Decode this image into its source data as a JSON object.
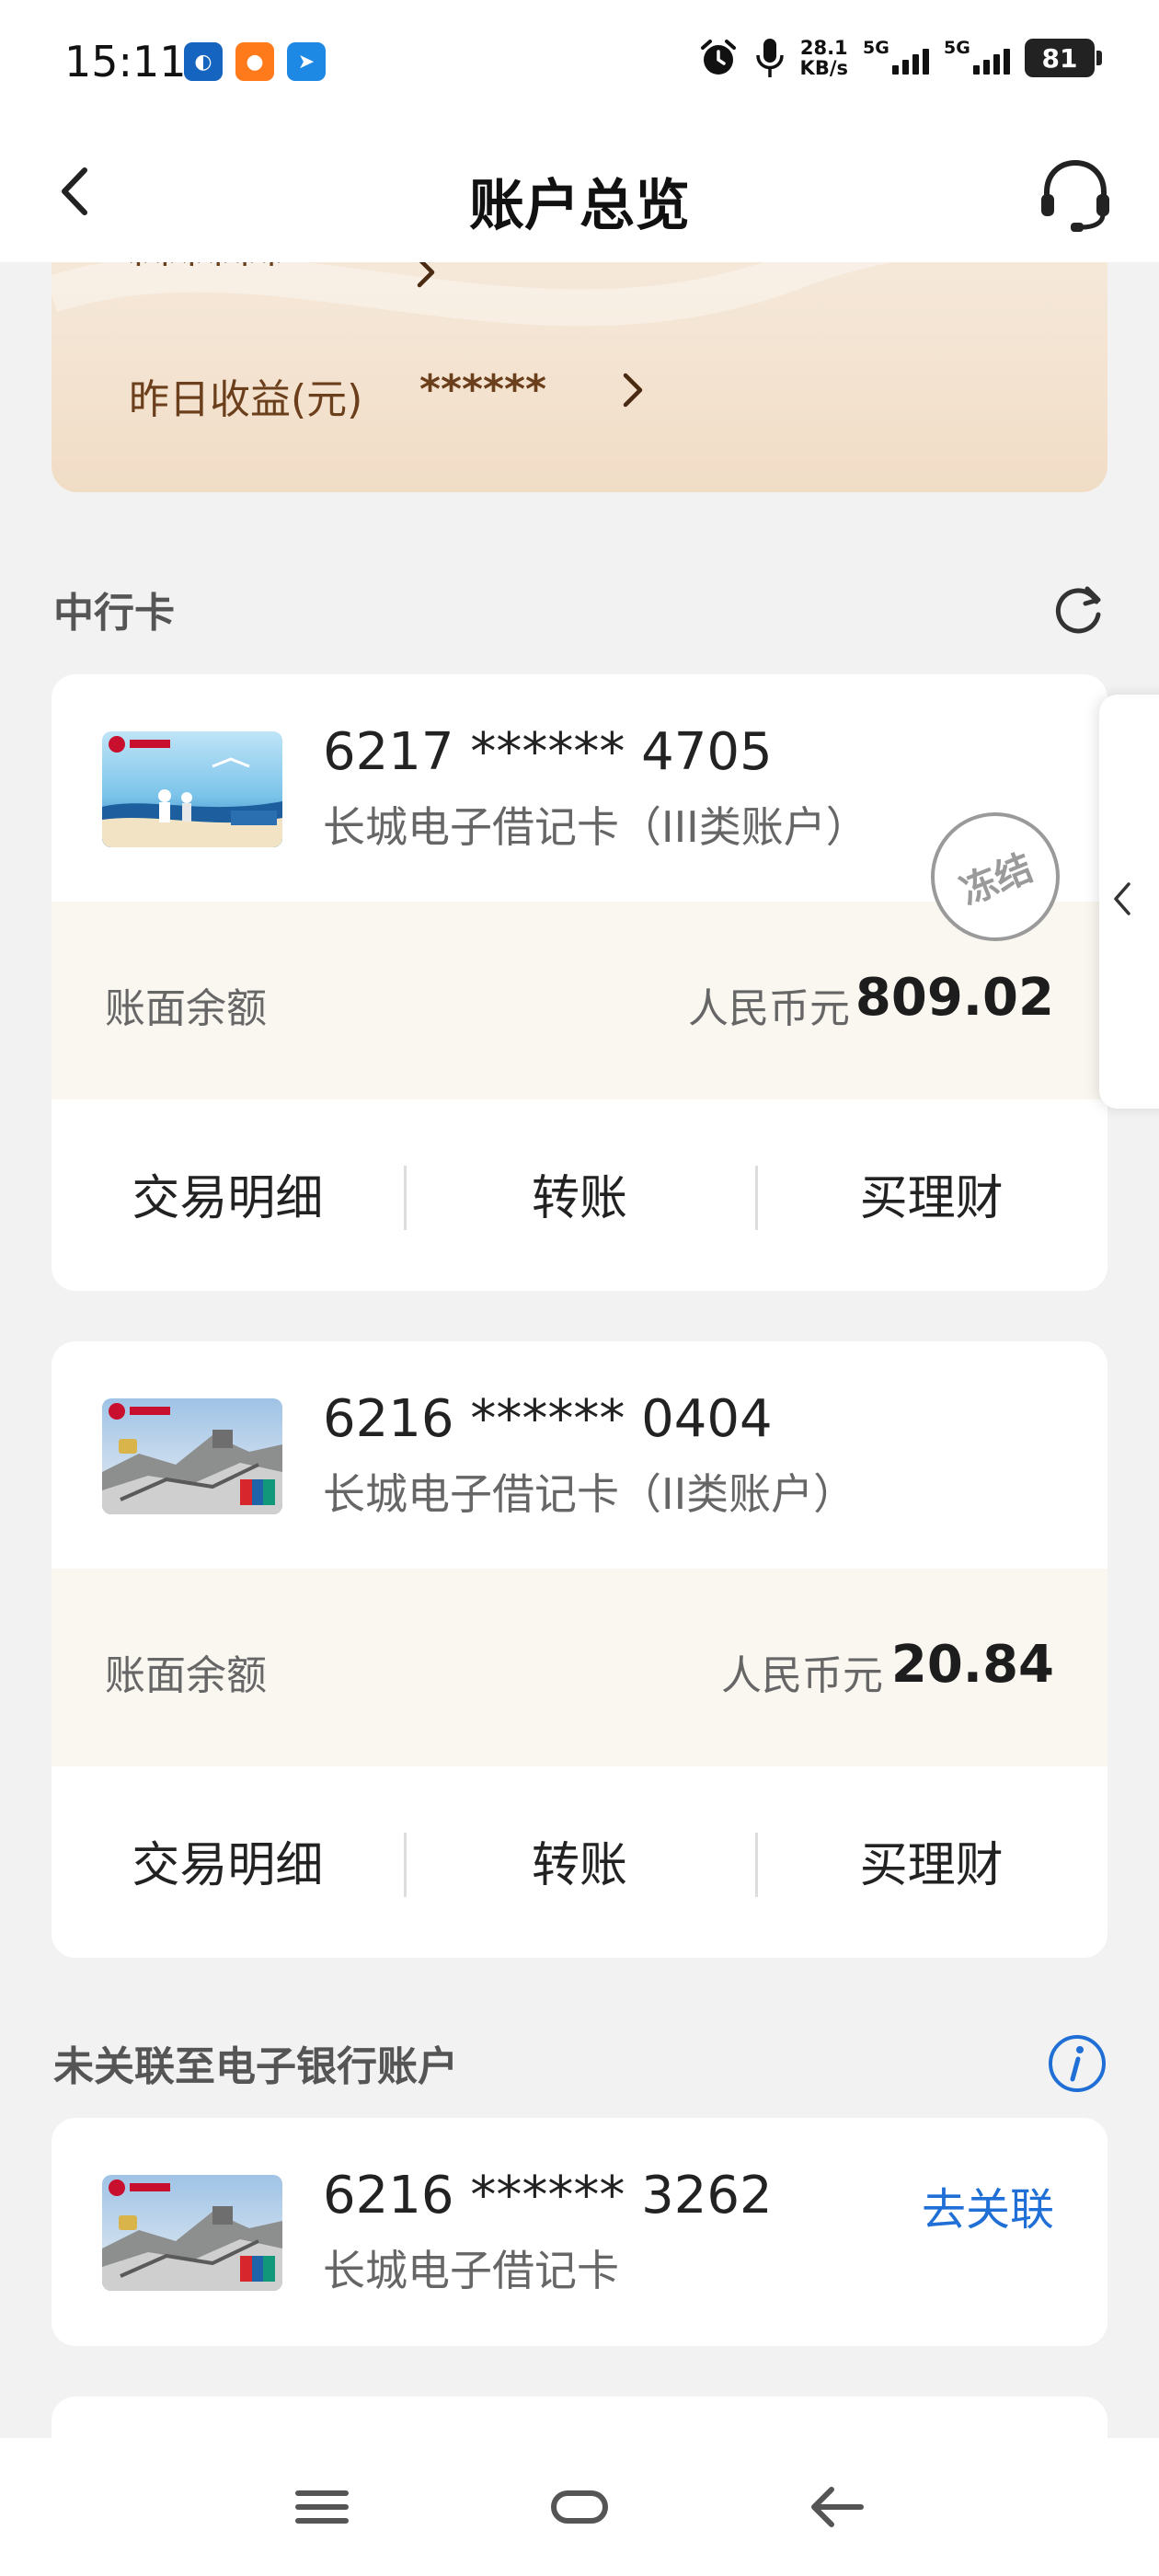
{
  "status_bar": {
    "time": "15:11",
    "net_speed_value": "28.1",
    "net_speed_unit": "KB/s",
    "signal1_label": "5G",
    "signal2_label": "5G",
    "battery": "81"
  },
  "header": {
    "title": "账户总览"
  },
  "wealth": {
    "hidden_value": "******",
    "yesterday_label": "昨日收益(元)",
    "yesterday_value": "******"
  },
  "boc_section": {
    "title": "中行卡"
  },
  "cards": [
    {
      "number": "6217 ****** 4705",
      "type": "长城电子借记卡（III类账户）",
      "stamp": "冻结",
      "balance_label": "账面余额",
      "currency": "人民币元",
      "amount": "809.02",
      "actions": [
        "交易明细",
        "转账",
        "买理财"
      ]
    },
    {
      "number": "6216 ****** 0404",
      "type": "长城电子借记卡（II类账户）",
      "balance_label": "账面余额",
      "currency": "人民币元",
      "amount": "20.84",
      "actions": [
        "交易明细",
        "转账",
        "买理财"
      ]
    }
  ],
  "unlinked_section": {
    "title": "未关联至电子银行账户",
    "card": {
      "number": "6216 ****** 3262",
      "type": "长城电子借记卡",
      "link_label": "去关联"
    }
  },
  "colors": {
    "accent_blue": "#1f6fd6",
    "wealth_text": "#6b3f1b",
    "balance_bg": "#faf6f0"
  }
}
